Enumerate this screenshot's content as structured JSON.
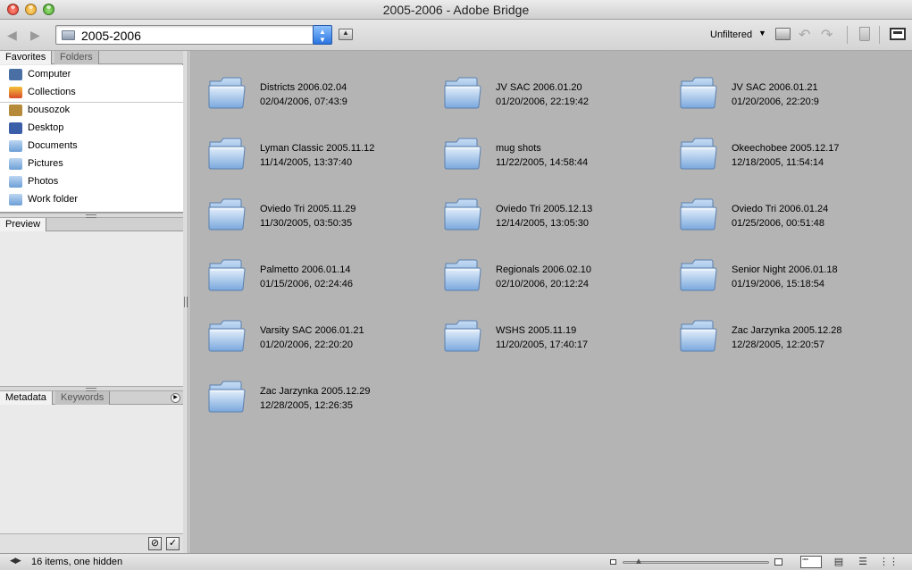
{
  "window": {
    "title": "2005-2006 - Adobe Bridge"
  },
  "toolbar": {
    "path": "2005-2006",
    "filter": "Unfiltered"
  },
  "left_panel": {
    "top_tabs": [
      "Favorites",
      "Folders"
    ],
    "favorites": [
      {
        "label": "Computer",
        "icon": "computer-icon",
        "color": "#4a6fa5"
      },
      {
        "label": "Collections",
        "icon": "collections-icon",
        "color": "#d94a2a"
      },
      {
        "label": "bousozok",
        "icon": "home-icon",
        "color": "#b58a3a"
      },
      {
        "label": "Desktop",
        "icon": "desktop-icon",
        "color": "#3a5fa8"
      },
      {
        "label": "Documents",
        "icon": "documents-folder-icon",
        "color": "#6d9fd6"
      },
      {
        "label": "Pictures",
        "icon": "pictures-folder-icon",
        "color": "#6d9fd6"
      },
      {
        "label": "Photos",
        "icon": "folder-icon",
        "color": "#6d9fd6"
      },
      {
        "label": "Work folder",
        "icon": "folder-icon",
        "color": "#6d9fd6"
      }
    ],
    "preview_tab": "Preview",
    "metadata_tabs": [
      "Metadata",
      "Keywords"
    ]
  },
  "content": {
    "folders": [
      {
        "name": "Districts 2006.02.04",
        "date": "02/04/2006, 07:43:9"
      },
      {
        "name": "JV SAC 2006.01.20",
        "date": "01/20/2006, 22:19:42"
      },
      {
        "name": "JV SAC 2006.01.21",
        "date": "01/20/2006, 22:20:9"
      },
      {
        "name": "Lyman Classic 2005.11.12",
        "date": "11/14/2005, 13:37:40"
      },
      {
        "name": "mug shots",
        "date": "11/22/2005, 14:58:44"
      },
      {
        "name": "Okeechobee 2005.12.17",
        "date": "12/18/2005, 11:54:14"
      },
      {
        "name": "Oviedo Tri 2005.11.29",
        "date": "11/30/2005, 03:50:35"
      },
      {
        "name": "Oviedo Tri 2005.12.13",
        "date": "12/14/2005, 13:05:30"
      },
      {
        "name": "Oviedo Tri 2006.01.24",
        "date": "01/25/2006, 00:51:48"
      },
      {
        "name": "Palmetto 2006.01.14",
        "date": "01/15/2006, 02:24:46"
      },
      {
        "name": "Regionals 2006.02.10",
        "date": "02/10/2006, 20:12:24"
      },
      {
        "name": "Senior Night 2006.01.18",
        "date": "01/19/2006, 15:18:54"
      },
      {
        "name": "Varsity SAC 2006.01.21",
        "date": "01/20/2006, 22:20:20"
      },
      {
        "name": "WSHS 2005.11.19",
        "date": "11/20/2005, 17:40:17"
      },
      {
        "name": "Zac Jarzynka 2005.12.28",
        "date": "12/28/2005, 12:20:57"
      },
      {
        "name": "Zac Jarzynka 2005.12.29",
        "date": "12/28/2005, 12:26:35"
      }
    ]
  },
  "status": {
    "text": "16 items, one hidden"
  },
  "colors": {
    "content_bg": "#b4b4b4",
    "accent": "#2a74e0"
  }
}
